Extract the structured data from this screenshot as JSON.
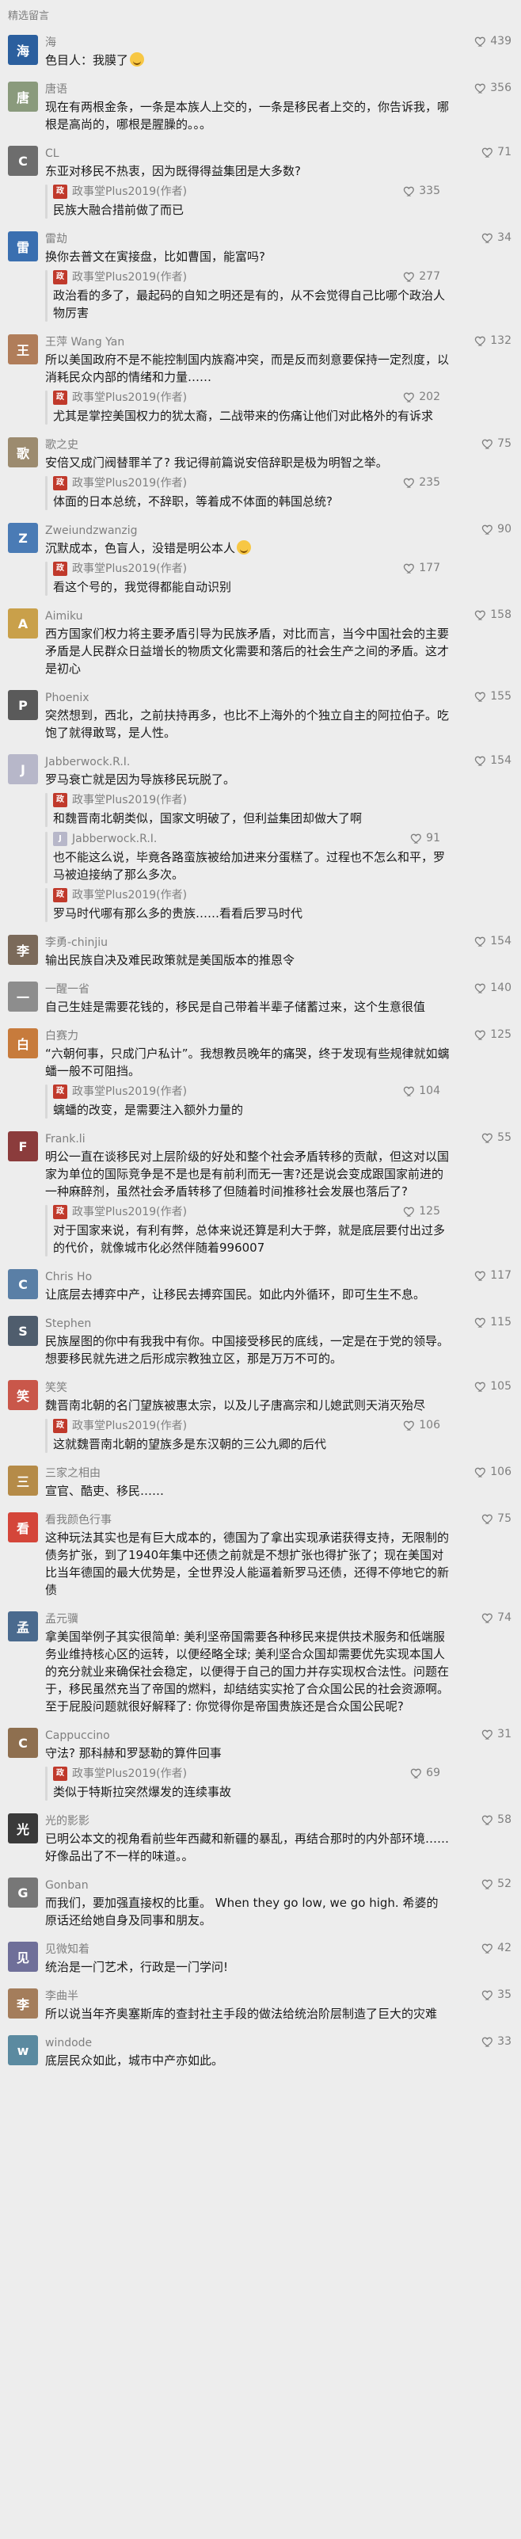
{
  "section_title": "精选留言",
  "author_name": "政事堂Plus2019(作者)",
  "comments": [
    {
      "name": "海",
      "likes": "439",
      "text": "色目人：我膜了",
      "emoji": true,
      "color": "#2b5f9e",
      "replies": []
    },
    {
      "name": "唐语",
      "likes": "356",
      "text": "现在有两根金条，一条是本族人上交的，一条是移民者上交的，你告诉我，哪根是高尚的，哪根是腥臊的。。。",
      "color": "#8a9a7c",
      "replies": []
    },
    {
      "name": "CL",
      "likes": "71",
      "text": "东亚对移民不热衷，因为既得得益集团是大多数?",
      "color": "#6d6d6d",
      "replies": [
        {
          "text": "民族大融合措前做了而已",
          "likes": "335"
        }
      ]
    },
    {
      "name": "雷劫",
      "likes": "34",
      "text": "换你去普文在寅接盘，比如曹国，能富吗?",
      "color": "#3a6fb0",
      "replies": [
        {
          "text": "政治看的多了，最起码的自知之明还是有的，从不会觉得自己比哪个政治人物厉害",
          "likes": "277"
        }
      ]
    },
    {
      "name": "王萍 Wang Yan",
      "likes": "132",
      "text": "所以美国政府不是不能控制国内族裔冲突，而是反而刻意要保持一定烈度，以消耗民众内部的情绪和力量……",
      "color": "#b07d5a",
      "replies": [
        {
          "text": "尤其是掌控美国权力的犹太裔，二战带来的伤痛让他们对此格外的有诉求",
          "likes": "202"
        }
      ]
    },
    {
      "name": "歌之史",
      "likes": "75",
      "text": "安倍又成门阀替罪羊了? 我记得前篇说安倍辞职是极为明智之举。",
      "color": "#9c8b6f",
      "replies": [
        {
          "text": "体面的日本总统，不辞职，等着成不体面的韩国总统?",
          "likes": "235"
        }
      ]
    },
    {
      "name": "Zweiundzwanzig",
      "likes": "90",
      "text": "沉默成本，色盲人，没错是明公本人",
      "emoji": true,
      "color": "#4a7bb5",
      "replies": [
        {
          "text": "看这个号的，我觉得都能自动识别",
          "likes": "177"
        }
      ]
    },
    {
      "name": "Aimiku",
      "likes": "158",
      "text": "西方国家们权力将主要矛盾引导为民族矛盾，对比而言，当今中国社会的主要矛盾是人民群众日益增长的物质文化需要和落后的社会生产之间的矛盾。这才是初心",
      "color": "#c9a04a",
      "replies": []
    },
    {
      "name": "Phoenix",
      "likes": "155",
      "text": "突然想到，西北，之前扶持再多，也比不上海外的个独立自主的阿拉伯子。吃饱了就得敢骂，是人性。",
      "color": "#5a5a5a",
      "replies": []
    },
    {
      "name": "Jabberwock.R.I.",
      "likes": "154",
      "text": "罗马衰亡就是因为导族移民玩脱了。",
      "color": "#b7b7c9",
      "replies": [
        {
          "text": "和魏晋南北朝类似，国家文明破了，但利益集团却做大了啊",
          "likes": ""
        },
        {
          "name": "Jabberwock.R.I.",
          "text": "也不能这么说，毕竟各路蛮族被给加进来分蛋糕了。过程也不怎么和平，罗马被迫接纳了那么多次。",
          "likes": "91"
        },
        {
          "text": "罗马时代哪有那么多的贵族……看看后罗马时代",
          "likes": ""
        }
      ]
    },
    {
      "name": "李勇-chinjiu",
      "likes": "154",
      "text": "输出民族自决及难民政策就是美国版本的推恩令",
      "color": "#7b6a5a",
      "replies": []
    },
    {
      "name": "一醒一省",
      "likes": "140",
      "text": "自己生娃是需要花钱的，移民是自己带着半辈子储蓄过来，这个生意很值",
      "color": "#8d8d8d",
      "replies": []
    },
    {
      "name": "白赛力",
      "likes": "125",
      "text": "“六朝何事，只成门户私计”。我想教员晚年的痛哭，终于发现有些规律就如螭蟠一般不可阻挡。",
      "color": "#c77b3c",
      "replies": [
        {
          "text": "螭蟠的改变，是需要注入额外力量的",
          "likes": "104"
        }
      ]
    },
    {
      "name": "Frank.li",
      "likes": "55",
      "text": "明公一直在谈移民对上层阶级的好处和整个社会矛盾转移的贡献，但这对以国家为单位的国际竞争是不是也是有前利而无一害?还是说会变成跟国家前进的一种麻醉剂，虽然社会矛盾转移了但随着时间推移社会发展也落后了?",
      "color": "#8b3c3c",
      "replies": [
        {
          "text": "对于国家来说，有利有弊，总体来说还算是利大于弊，就是底层要付出过多的代价，就像城市化必然伴随着996007",
          "likes": "125"
        }
      ]
    },
    {
      "name": "Chris Ho",
      "likes": "117",
      "text": "让底层去搏弈中产，让移民去搏弈国民。如此内外循环，即可生生不息。",
      "color": "#5a7fa6",
      "replies": []
    },
    {
      "name": "Stephen",
      "likes": "115",
      "text": "民族屋图的你中有我我中有你。中国接受移民的底线，一定是在于党的领导。想要移民就先进之后形成宗教独立区，那是万万不可的。",
      "color": "#4f5d6d",
      "replies": []
    },
    {
      "name": "笑笑",
      "likes": "105",
      "text": "魏晋南北朝的名门望族被惠太宗，以及儿子唐高宗和儿媳武则天消灭殆尽",
      "color": "#c9574a",
      "replies": [
        {
          "text": "这就魏晋南北朝的望族多是东汉朝的三公九卿的后代",
          "likes": "106"
        }
      ]
    },
    {
      "name": "三家之相由",
      "likes": "106",
      "text": "宣官、酷吏、移民……",
      "color": "#b58b48",
      "replies": []
    },
    {
      "name": "看我颜色行事",
      "likes": "75",
      "text": "这种玩法其实也是有巨大成本的，德国为了拿出实现承诺获得支持，无限制的债务扩张，到了1940年集中还债之前就是不想扩张也得扩张了；现在美国对比当年德国的最大优势是，全世界没人能逼着新罗马还债，还得不停地它的新债",
      "color": "#d4463a",
      "replies": []
    },
    {
      "name": "孟元骥",
      "likes": "74",
      "text": "拿美国举例子其实很简单: 美利坚帝国需要各种移民来提供技术服务和低端服务业维持核心区的运转，以便经略全球; 美利坚合众国却需要优先实现本国人的充分就业来确保社会稳定，以便得于自己的国力并存实现权合法性。问题在于，移民虽然充当了帝国的燃料，却结结实实抢了合众国公民的社会资源啊。至于屁股问题就很好解释了: 你觉得你是帝国贵族还是合众国公民呢?",
      "color": "#4a6a8e",
      "replies": []
    },
    {
      "name": "Cappuccino",
      "likes": "31",
      "text": "守法? 那科赫和罗瑟勒的算件回事",
      "color": "#8e6f4f",
      "replies": [
        {
          "text": "类似于特斯拉突然爆发的连续事故",
          "likes": "69"
        }
      ]
    },
    {
      "name": "光的影影",
      "likes": "58",
      "text": "已明公本文的视角看前些年西藏和新疆的暴乱，再结合那时的内外部环境……好像品出了不一样的味道。。",
      "color": "#3a3a3a",
      "replies": []
    },
    {
      "name": "Gonban",
      "likes": "52",
      "text": "而我们，要加强直接权的比重。 When they go low,  we go high. 希婆的原话还给她自身及同事和朋友。",
      "color": "#777777",
      "replies": []
    },
    {
      "name": "见微知着",
      "likes": "42",
      "text": "统治是一门艺术，行政是一门学问!",
      "color": "#6f6f99",
      "replies": []
    },
    {
      "name": "李曲半",
      "likes": "35",
      "text": "所以说当年齐奥塞斯库的查封社主手段的做法给统治阶层制造了巨大的灾难",
      "color": "#a47d5b",
      "replies": []
    },
    {
      "name": "windode",
      "likes": "33",
      "text": "底层民众如此，城市中产亦如此。",
      "color": "#5b8aa0",
      "replies": []
    }
  ]
}
